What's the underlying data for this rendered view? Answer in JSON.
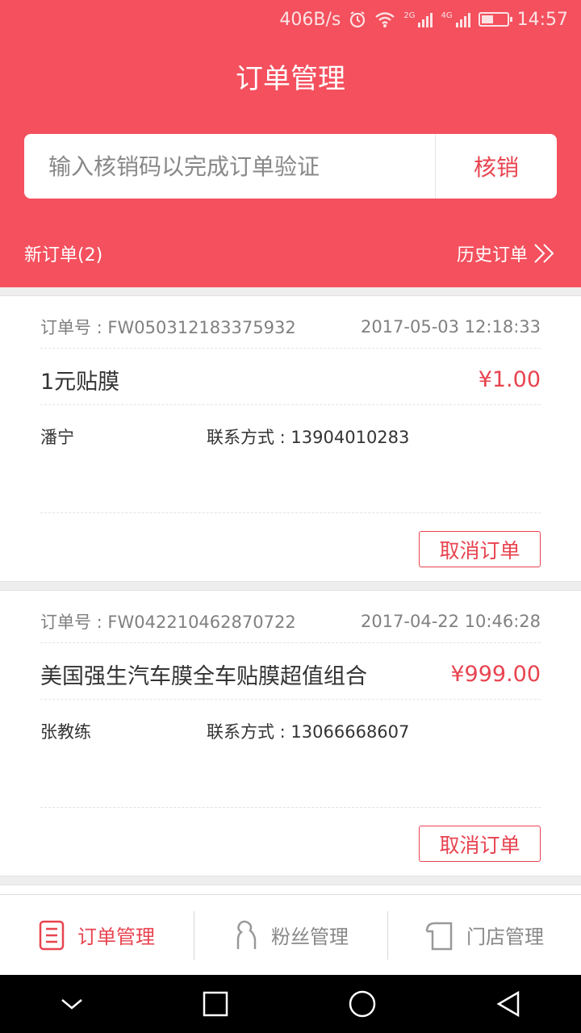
{
  "status_bar": {
    "speed": "406B/s",
    "net_2g": "2G",
    "net_4g": "4G",
    "time": "14:57",
    "icons": [
      "alarm-icon",
      "wifi-icon",
      "signal-icon",
      "battery-icon"
    ]
  },
  "header": {
    "title": "订单管理",
    "background_color": "#f4505e"
  },
  "search": {
    "placeholder": "输入核销码以完成订单验证",
    "value": "",
    "button_label": "核销"
  },
  "tabs": {
    "new_orders": "新订单(2)",
    "history": "历史订单"
  },
  "orders": [
    {
      "order_no": "订单号 : FW050312183375932",
      "date": "2017-05-03 12:18:33",
      "product": "1元贴膜",
      "price": "¥1.00",
      "customer": "潘宁",
      "contact": "联系方式 : 13904010283",
      "cancel_label": "取消订单"
    },
    {
      "order_no": "订单号 : FW042210462870722",
      "date": "2017-04-22 10:46:28",
      "product": "美国强生汽车膜全车贴膜超值组合",
      "price": "¥999.00",
      "customer": "张教练",
      "contact": "联系方式 : 13066668607",
      "cancel_label": "取消订单"
    }
  ],
  "bottom_nav": [
    {
      "label": "订单管理",
      "icon": "order-list-icon",
      "active": true
    },
    {
      "label": "粉丝管理",
      "icon": "fans-icon",
      "active": false
    },
    {
      "label": "门店管理",
      "icon": "store-icon",
      "active": false
    }
  ],
  "accent_color": "#e8434f"
}
